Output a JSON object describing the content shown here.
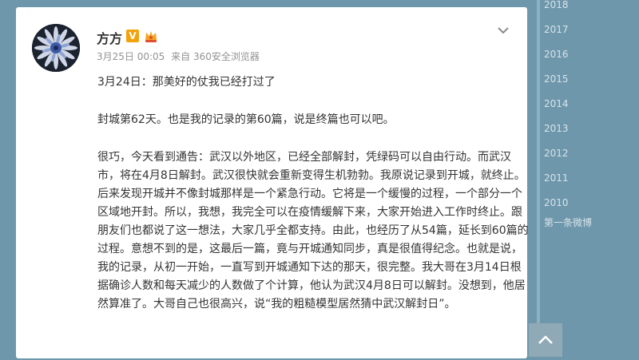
{
  "post": {
    "author": "方方",
    "verified_badge": "V",
    "vip_icon": "vip-crown-icon",
    "date": "3月25日 00:05",
    "source": "来自 360安全浏览器",
    "paragraphs": [
      "3月24日：那美好的仗我已经打过了",
      "封城第62天。也是我的记录的第60篇，说是终篇也可以吧。",
      "很巧，今天看到通告：武汉以外地区，已经全部解封，凭绿码可以自由行动。而武汉市，将在4月8日解封。武汉很快就会重新变得生机勃勃。我原说记录到开城，就终止。后来发现开城并不像封城那样是一个紧急行动。它将是一个缓慢的过程，一个部分一个区域地开封。所以，我想，我完全可以在疫情缓解下来，大家开始进入工作时终止。跟朋友们也都说了这一想法，大家几乎全都支持。由此，也经历了从54篇，延长到60篇的过程。意想不到的是，这最后一篇，竟与开城通知同步，真是很值得纪念。也就是说，我的记录，从初一开始，一直写到开城通知下达的那天，很完整。我大哥在3月14日根据确诊人数和每天减少的人数做了个计算，他认为武汉4月8日可以解封。没想到，他居然算准了。大哥自己也很高兴，说“我的粗糙模型居然猜中武汉解封日”。"
    ]
  },
  "timeline": {
    "years": [
      "2018",
      "2017",
      "2016",
      "2015",
      "2014",
      "2013",
      "2012",
      "2011",
      "2010"
    ],
    "first_post": "第一条微博"
  },
  "colors": {
    "background": "#6f97ab",
    "card": "#ffffff",
    "timeline_text": "#d6e3ea",
    "badge": "#f2a20a"
  }
}
